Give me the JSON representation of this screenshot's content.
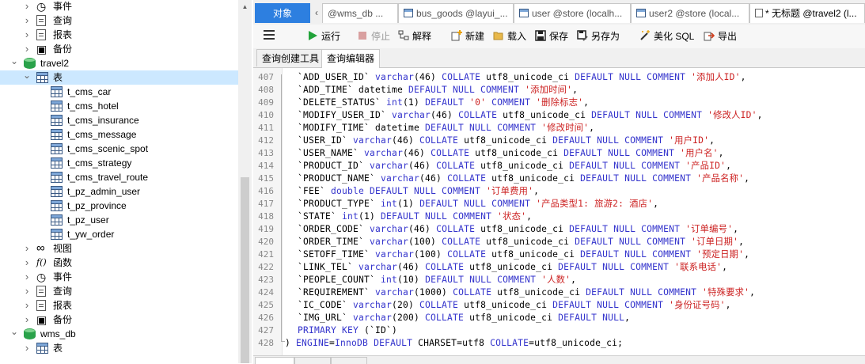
{
  "tree": {
    "items": [
      {
        "label": "事件",
        "icon": "event-icon",
        "chevron": "collapsed"
      },
      {
        "label": "查询",
        "icon": "query-icon",
        "chevron": "collapsed"
      },
      {
        "label": "报表",
        "icon": "report-icon",
        "chevron": "collapsed"
      },
      {
        "label": "备份",
        "icon": "backup-icon",
        "chevron": "collapsed"
      },
      {
        "label": "travel2",
        "icon": "database-icon",
        "chevron": "expanded"
      },
      {
        "label": "表",
        "icon": "table-group-icon",
        "chevron": "expanded",
        "selected": true
      },
      {
        "label": "t_cms_car",
        "icon": "table-icon"
      },
      {
        "label": "t_cms_hotel",
        "icon": "table-icon"
      },
      {
        "label": "t_cms_insurance",
        "icon": "table-icon"
      },
      {
        "label": "t_cms_message",
        "icon": "table-icon"
      },
      {
        "label": "t_cms_scenic_spot",
        "icon": "table-icon"
      },
      {
        "label": "t_cms_strategy",
        "icon": "table-icon"
      },
      {
        "label": "t_cms_travel_route",
        "icon": "table-icon"
      },
      {
        "label": "t_pz_admin_user",
        "icon": "table-icon"
      },
      {
        "label": "t_pz_province",
        "icon": "table-icon"
      },
      {
        "label": "t_pz_user",
        "icon": "table-icon"
      },
      {
        "label": "t_yw_order",
        "icon": "table-icon"
      },
      {
        "label": "视图",
        "icon": "view-icon",
        "chevron": "collapsed"
      },
      {
        "label": "函数",
        "icon": "function-icon",
        "chevron": "collapsed"
      },
      {
        "label": "事件",
        "icon": "event-icon",
        "chevron": "collapsed"
      },
      {
        "label": "查询",
        "icon": "query-icon",
        "chevron": "collapsed"
      },
      {
        "label": "报表",
        "icon": "report-icon",
        "chevron": "collapsed"
      },
      {
        "label": "备份",
        "icon": "backup-icon",
        "chevron": "collapsed"
      },
      {
        "label": "wms_db",
        "icon": "database-icon",
        "chevron": "expanded"
      },
      {
        "label": "表",
        "icon": "table-group-icon",
        "chevron": "collapsed"
      }
    ]
  },
  "tabs": {
    "objects": "对象",
    "items": [
      "@wms_db ...",
      "bus_goods @layui_...",
      "user @store (localh...",
      "user2 @store (local...",
      "* 无标题 @travel2 (l..."
    ]
  },
  "toolbar": {
    "run": "运行",
    "stop": "停止",
    "explain": "解释",
    "new": "新建",
    "load": "载入",
    "save": "保存",
    "save_as": "另存为",
    "beautify": "美化 SQL",
    "export": "导出"
  },
  "subtabs": {
    "builder": "查询创建工具",
    "editor": "查询编辑器"
  },
  "editor": {
    "lines": [
      {
        "n": "407",
        "parts": [
          [
            "  `ADD_USER_ID` ",
            ""
          ],
          [
            "varchar",
            "kw"
          ],
          [
            "(46) ",
            ""
          ],
          [
            "COLLATE",
            "kw"
          ],
          [
            " utf8_unicode_ci ",
            ""
          ],
          [
            "DEFAULT NULL COMMENT",
            "kw"
          ],
          [
            " ",
            ""
          ],
          [
            "'添加人ID'",
            "str"
          ],
          [
            ",",
            ""
          ]
        ]
      },
      {
        "n": "408",
        "parts": [
          [
            "  `ADD_TIME` datetime ",
            ""
          ],
          [
            "DEFAULT NULL COMMENT",
            "kw"
          ],
          [
            " ",
            ""
          ],
          [
            "'添加时间'",
            "str"
          ],
          [
            ",",
            ""
          ]
        ]
      },
      {
        "n": "409",
        "parts": [
          [
            "  `DELETE_STATUS` ",
            ""
          ],
          [
            "int",
            "kw"
          ],
          [
            "(1) ",
            ""
          ],
          [
            "DEFAULT",
            "kw"
          ],
          [
            " ",
            ""
          ],
          [
            "'0'",
            "str"
          ],
          [
            " ",
            ""
          ],
          [
            "COMMENT",
            "kw"
          ],
          [
            " ",
            ""
          ],
          [
            "'删除标志'",
            "str"
          ],
          [
            ",",
            ""
          ]
        ]
      },
      {
        "n": "410",
        "parts": [
          [
            "  `MODIFY_USER_ID` ",
            ""
          ],
          [
            "varchar",
            "kw"
          ],
          [
            "(46) ",
            ""
          ],
          [
            "COLLATE",
            "kw"
          ],
          [
            " utf8_unicode_ci ",
            ""
          ],
          [
            "DEFAULT NULL COMMENT",
            "kw"
          ],
          [
            " ",
            ""
          ],
          [
            "'修改人ID'",
            "str"
          ],
          [
            ",",
            ""
          ]
        ]
      },
      {
        "n": "411",
        "parts": [
          [
            "  `MODIFY_TIME` datetime ",
            ""
          ],
          [
            "DEFAULT NULL COMMENT",
            "kw"
          ],
          [
            " ",
            ""
          ],
          [
            "'修改时间'",
            "str"
          ],
          [
            ",",
            ""
          ]
        ]
      },
      {
        "n": "412",
        "parts": [
          [
            "  `USER_ID` ",
            ""
          ],
          [
            "varchar",
            "kw"
          ],
          [
            "(46) ",
            ""
          ],
          [
            "COLLATE",
            "kw"
          ],
          [
            " utf8_unicode_ci ",
            ""
          ],
          [
            "DEFAULT NULL COMMENT",
            "kw"
          ],
          [
            " ",
            ""
          ],
          [
            "'用户ID'",
            "str"
          ],
          [
            ",",
            ""
          ]
        ]
      },
      {
        "n": "413",
        "parts": [
          [
            "  `USER_NAME` ",
            ""
          ],
          [
            "varchar",
            "kw"
          ],
          [
            "(46) ",
            ""
          ],
          [
            "COLLATE",
            "kw"
          ],
          [
            " utf8_unicode_ci ",
            ""
          ],
          [
            "DEFAULT NULL COMMENT",
            "kw"
          ],
          [
            " ",
            ""
          ],
          [
            "'用户名'",
            "str"
          ],
          [
            ",",
            ""
          ]
        ]
      },
      {
        "n": "414",
        "parts": [
          [
            "  `PRODUCT_ID` ",
            ""
          ],
          [
            "varchar",
            "kw"
          ],
          [
            "(46) ",
            ""
          ],
          [
            "COLLATE",
            "kw"
          ],
          [
            " utf8_unicode_ci ",
            ""
          ],
          [
            "DEFAULT NULL COMMENT",
            "kw"
          ],
          [
            " ",
            ""
          ],
          [
            "'产品ID'",
            "str"
          ],
          [
            ",",
            ""
          ]
        ]
      },
      {
        "n": "415",
        "parts": [
          [
            "  `PRODUCT_NAME` ",
            ""
          ],
          [
            "varchar",
            "kw"
          ],
          [
            "(46) ",
            ""
          ],
          [
            "COLLATE",
            "kw"
          ],
          [
            " utf8_unicode_ci ",
            ""
          ],
          [
            "DEFAULT NULL COMMENT",
            "kw"
          ],
          [
            " ",
            ""
          ],
          [
            "'产品名称'",
            "str"
          ],
          [
            ",",
            ""
          ]
        ]
      },
      {
        "n": "416",
        "parts": [
          [
            "  `FEE` ",
            ""
          ],
          [
            "double DEFAULT NULL COMMENT",
            "kw"
          ],
          [
            " ",
            ""
          ],
          [
            "'订单费用'",
            "str"
          ],
          [
            ",",
            ""
          ]
        ]
      },
      {
        "n": "417",
        "parts": [
          [
            "  `PRODUCT_TYPE` ",
            ""
          ],
          [
            "int",
            "kw"
          ],
          [
            "(1) ",
            ""
          ],
          [
            "DEFAULT NULL COMMENT",
            "kw"
          ],
          [
            " ",
            ""
          ],
          [
            "'产品类型1: 旅游2: 酒店'",
            "str"
          ],
          [
            ",",
            ""
          ]
        ]
      },
      {
        "n": "418",
        "parts": [
          [
            "  `STATE` ",
            ""
          ],
          [
            "int",
            "kw"
          ],
          [
            "(1) ",
            ""
          ],
          [
            "DEFAULT NULL COMMENT",
            "kw"
          ],
          [
            " ",
            ""
          ],
          [
            "'状态'",
            "str"
          ],
          [
            ",",
            ""
          ]
        ]
      },
      {
        "n": "419",
        "parts": [
          [
            "  `ORDER_CODE` ",
            ""
          ],
          [
            "varchar",
            "kw"
          ],
          [
            "(46) ",
            ""
          ],
          [
            "COLLATE",
            "kw"
          ],
          [
            " utf8_unicode_ci ",
            ""
          ],
          [
            "DEFAULT NULL COMMENT",
            "kw"
          ],
          [
            " ",
            ""
          ],
          [
            "'订单编号'",
            "str"
          ],
          [
            ",",
            ""
          ]
        ]
      },
      {
        "n": "420",
        "parts": [
          [
            "  `ORDER_TIME` ",
            ""
          ],
          [
            "varchar",
            "kw"
          ],
          [
            "(100) ",
            ""
          ],
          [
            "COLLATE",
            "kw"
          ],
          [
            " utf8_unicode_ci ",
            ""
          ],
          [
            "DEFAULT NULL COMMENT",
            "kw"
          ],
          [
            " ",
            ""
          ],
          [
            "'订单日期'",
            "str"
          ],
          [
            ",",
            ""
          ]
        ]
      },
      {
        "n": "421",
        "parts": [
          [
            "  `SETOFF_TIME` ",
            ""
          ],
          [
            "varchar",
            "kw"
          ],
          [
            "(100) ",
            ""
          ],
          [
            "COLLATE",
            "kw"
          ],
          [
            " utf8_unicode_ci ",
            ""
          ],
          [
            "DEFAULT NULL COMMENT",
            "kw"
          ],
          [
            " ",
            ""
          ],
          [
            "'预定日期'",
            "str"
          ],
          [
            ",",
            ""
          ]
        ]
      },
      {
        "n": "422",
        "parts": [
          [
            "  `LINK_TEL` ",
            ""
          ],
          [
            "varchar",
            "kw"
          ],
          [
            "(46) ",
            ""
          ],
          [
            "COLLATE",
            "kw"
          ],
          [
            " utf8_unicode_ci ",
            ""
          ],
          [
            "DEFAULT NULL COMMENT",
            "kw"
          ],
          [
            " ",
            ""
          ],
          [
            "'联系电话'",
            "str"
          ],
          [
            ",",
            ""
          ]
        ]
      },
      {
        "n": "423",
        "parts": [
          [
            "  `PEOPLE_COUNT` ",
            ""
          ],
          [
            "int",
            "kw"
          ],
          [
            "(10) ",
            ""
          ],
          [
            "DEFAULT NULL COMMENT",
            "kw"
          ],
          [
            " ",
            ""
          ],
          [
            "'人数'",
            "str"
          ],
          [
            ",",
            ""
          ]
        ]
      },
      {
        "n": "424",
        "parts": [
          [
            "  `REQUIREMENT` ",
            ""
          ],
          [
            "varchar",
            "kw"
          ],
          [
            "(1000) ",
            ""
          ],
          [
            "COLLATE",
            "kw"
          ],
          [
            " utf8_unicode_ci ",
            ""
          ],
          [
            "DEFAULT NULL COMMENT",
            "kw"
          ],
          [
            " ",
            ""
          ],
          [
            "'特殊要求'",
            "str"
          ],
          [
            ",",
            ""
          ]
        ]
      },
      {
        "n": "425",
        "parts": [
          [
            "  `IC_CODE` ",
            ""
          ],
          [
            "varchar",
            "kw"
          ],
          [
            "(20) ",
            ""
          ],
          [
            "COLLATE",
            "kw"
          ],
          [
            " utf8_unicode_ci ",
            ""
          ],
          [
            "DEFAULT NULL COMMENT",
            "kw"
          ],
          [
            " ",
            ""
          ],
          [
            "'身份证号码'",
            "str"
          ],
          [
            ",",
            ""
          ]
        ]
      },
      {
        "n": "426",
        "parts": [
          [
            "  `IMG_URL` ",
            ""
          ],
          [
            "varchar",
            "kw"
          ],
          [
            "(200) ",
            ""
          ],
          [
            "COLLATE",
            "kw"
          ],
          [
            " utf8_unicode_ci ",
            ""
          ],
          [
            "DEFAULT NULL",
            "kw"
          ],
          [
            ",",
            ""
          ]
        ]
      },
      {
        "n": "427",
        "parts": [
          [
            "  ",
            ""
          ],
          [
            "PRIMARY KEY",
            "kw"
          ],
          [
            " (`ID`)",
            ""
          ]
        ]
      },
      {
        "n": "428",
        "parts": [
          [
            ") ",
            ""
          ],
          [
            "ENGINE",
            "kw"
          ],
          [
            "=",
            ""
          ],
          [
            "InnoDB",
            "kw"
          ],
          [
            " ",
            ""
          ],
          [
            "DEFAULT",
            "kw"
          ],
          [
            " CHARSET=utf8 ",
            ""
          ],
          [
            "COLLATE",
            "kw"
          ],
          [
            "=utf8_unicode_ci;",
            ""
          ]
        ]
      }
    ]
  },
  "colors": {
    "accent": "#2d7fe0",
    "keyword": "#3333cc",
    "string": "#cc2222",
    "selection": "#cce8ff"
  }
}
